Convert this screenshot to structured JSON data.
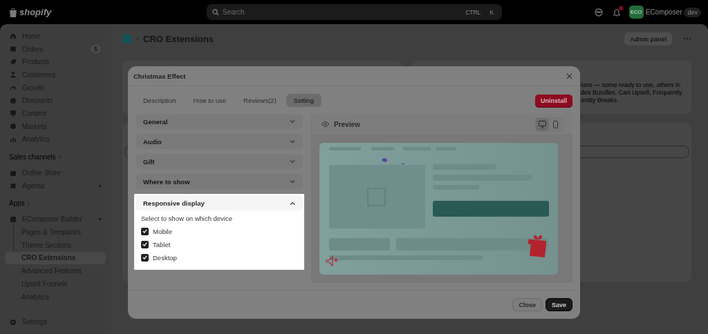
{
  "top_bar": {
    "logo": "shopify",
    "search": {
      "placeholder": "Search",
      "shortcut": [
        "CTRL",
        "K"
      ]
    },
    "notification_badge": true,
    "store": {
      "avatar": "ECO",
      "name": "EComposer",
      "badge": "dev"
    }
  },
  "sidebar": {
    "items": [
      {
        "label": "Home",
        "selected": false
      },
      {
        "label": "Orders",
        "count": "5",
        "selected": false
      },
      {
        "label": "Products",
        "selected": false
      },
      {
        "label": "Customers",
        "selected": false
      },
      {
        "label": "Growth",
        "selected": false
      },
      {
        "label": "Discounts",
        "selected": false
      },
      {
        "label": "Content",
        "selected": false
      },
      {
        "label": "Markets",
        "selected": false
      },
      {
        "label": "Analytics",
        "selected": false
      }
    ],
    "groups": [
      {
        "heading": "Sales channels",
        "items": [
          {
            "label": "Online Store",
            "dot": false,
            "selected": false
          },
          {
            "label": "Agentic",
            "dot": true,
            "selected": false
          }
        ]
      },
      {
        "heading": "Apps",
        "items": [
          {
            "label": "EComposer Builder",
            "dot": true,
            "selected": false,
            "children": [
              {
                "label": "Pages & Templates",
                "selected": false
              },
              {
                "label": "Theme Sections",
                "selected": false
              },
              {
                "label": "CRO Extensions",
                "selected": true
              },
              {
                "label": "Advanced Features",
                "selected": false
              },
              {
                "label": "Upsell Funnels",
                "selected": false
              },
              {
                "label": "Analytics",
                "selected": false
              }
            ]
          }
        ]
      }
    ],
    "footer": {
      "label": "Settings"
    }
  },
  "page": {
    "title": "CRO Extensions",
    "admin_button": "Admin panel",
    "card_text": [
      "ions — some ready to use, others in",
      "des Bundles, Cart Upsell, Frequently",
      "antity Breaks."
    ]
  },
  "modal": {
    "title": "Christmas Effect",
    "tabs": [
      {
        "label": "Description",
        "selected": false
      },
      {
        "label": "How to use",
        "selected": false
      },
      {
        "label": "Reviews(2)",
        "selected": false
      },
      {
        "label": "Setting",
        "selected": true
      }
    ],
    "uninstall_button": "Uninstall",
    "sections": [
      {
        "title": "General",
        "expanded": false,
        "highlighted": false
      },
      {
        "title": "Audio",
        "expanded": false,
        "highlighted": false
      },
      {
        "title": "Gift",
        "expanded": false,
        "highlighted": false
      },
      {
        "title": "Where to show",
        "expanded": false,
        "highlighted": false
      },
      {
        "title": "Responsive display",
        "expanded": true,
        "highlighted": true,
        "prompt": "Select to show on which device",
        "options": [
          {
            "label": "Mobile",
            "checked": true
          },
          {
            "label": "Tablet",
            "checked": true
          },
          {
            "label": "Desktop",
            "checked": true
          }
        ]
      }
    ],
    "preview": {
      "label": "Preview",
      "devices": [
        {
          "kind": "desktop",
          "selected": true
        },
        {
          "kind": "mobile",
          "selected": false
        }
      ]
    },
    "buttons": [
      {
        "label": "Close",
        "kind": "secondary"
      },
      {
        "label": "Save",
        "kind": "primary"
      }
    ]
  }
}
